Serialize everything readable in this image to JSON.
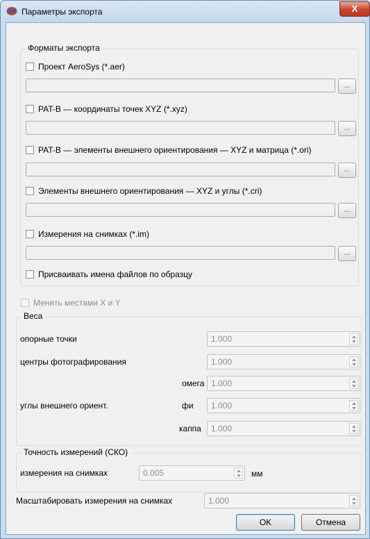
{
  "window": {
    "title": "Параметры экспорта",
    "close_label": "X"
  },
  "formats": {
    "legend": "Форматы экспорта",
    "items": [
      {
        "label": "Проект AeroSys (*.aer)",
        "path": "",
        "browse": "..."
      },
      {
        "label": "PAT-B — координаты точек XYZ (*.xyz)",
        "path": "",
        "browse": "..."
      },
      {
        "label": "PAT-B — элементы внешнего ориентирования — XYZ и матрица (*.ori)",
        "path": "",
        "browse": "..."
      },
      {
        "label": "Элементы внешнего ориентирования — XYZ и углы (*.cri)",
        "path": "",
        "browse": "..."
      },
      {
        "label": "Измерения на снимках (*.im)",
        "path": "",
        "browse": "..."
      }
    ],
    "assign_names": "Присваивать имена файлов по образцу"
  },
  "swap_xy": "Менять местами X и Y",
  "weights": {
    "legend": "Веса",
    "control_points": {
      "label": "опорные точки",
      "value": "1.000"
    },
    "photo_centers": {
      "label": "центры фотографирования",
      "value": "1.000"
    },
    "angles_label": "углы внешнего ориент.",
    "omega": {
      "label": "омега",
      "value": "1.000"
    },
    "phi": {
      "label": "фи",
      "value": "1.000"
    },
    "kappa": {
      "label": "каппа",
      "value": "1.000"
    }
  },
  "accuracy": {
    "legend": "Точность измерений (СКО)",
    "label": "измерения на снимках",
    "value": "0.005",
    "unit": "мм"
  },
  "scale": {
    "label": "Масштабировать измерения на снимках",
    "value": "1.000"
  },
  "buttons": {
    "ok": "OK",
    "cancel": "Отмена"
  }
}
